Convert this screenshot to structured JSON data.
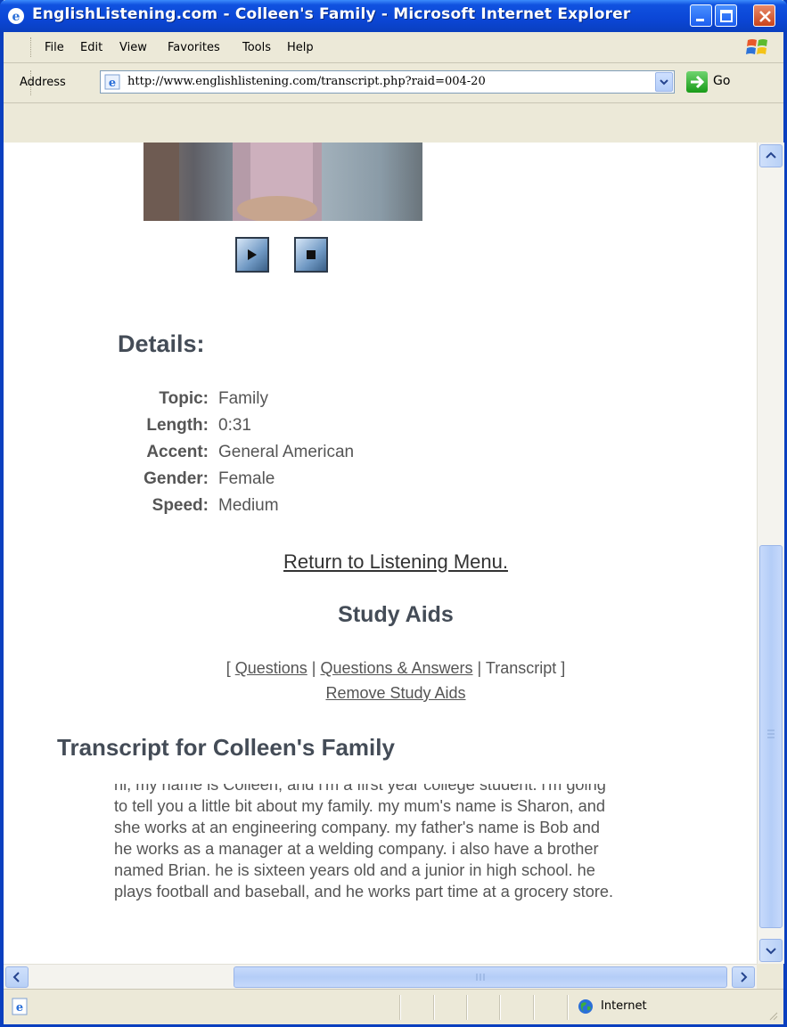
{
  "window": {
    "title": "EnglishListening.com - Colleen's Family - Microsoft Internet Explorer"
  },
  "menubar": {
    "items": [
      "File",
      "Edit",
      "View",
      "Favorites",
      "Tools",
      "Help"
    ]
  },
  "addressbar": {
    "label": "Address",
    "url": "http://www.englishlistening.com/transcript.php?raid=004-20",
    "go_label": "Go"
  },
  "details": {
    "heading": "Details:",
    "rows": [
      {
        "label": "Topic:",
        "value": "Family"
      },
      {
        "label": "Length:",
        "value": "0:31"
      },
      {
        "label": "Accent:",
        "value": "General American"
      },
      {
        "label": "Gender:",
        "value": "Female"
      },
      {
        "label": "Speed:",
        "value": "Medium"
      }
    ]
  },
  "links": {
    "return_menu": "Return to Listening Menu.",
    "study_aids_heading": "Study Aids",
    "questions": "Questions",
    "questions_answers": "Questions & Answers",
    "transcript": "Transcript",
    "remove_aids": "Remove Study Aids"
  },
  "transcript": {
    "heading": "Transcript for Colleen's Family",
    "lines": [
      "hi, my name is Colleen, and i'm a first year college student. i'm going",
      "to tell you a little bit about my family. my mum's name is Sharon, and",
      "she works at an engineering company. my father's name is Bob and",
      "he works as a manager at a welding company. i also have a brother",
      "named Brian. he is sixteen years old and a junior in high school. he",
      "plays football and baseball, and he works part time at a grocery store."
    ]
  },
  "statusbar": {
    "zone": "Internet"
  }
}
